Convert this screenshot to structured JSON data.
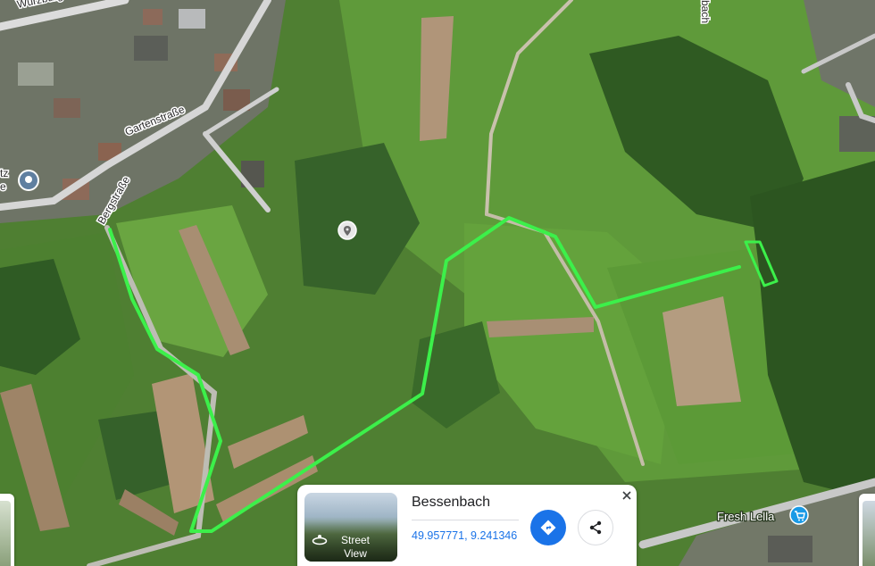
{
  "map": {
    "type": "satellite",
    "road_labels": {
      "wurzburger": "Würzburger Str.",
      "garten": "Gartenstraße",
      "berg": "Bergstraße",
      "bach": "bach",
      "left_edge_top": "tz",
      "left_edge_bottom": "e"
    },
    "place_label": "Fresh Lella",
    "route_color": "#3cf04a",
    "icons": [
      "location-pin-icon",
      "place-pin-icon",
      "shopping-cart-icon"
    ]
  },
  "info_card": {
    "place_name": "Bessenbach",
    "coordinates": "49.957771, 9.241346",
    "street_view_line1": "Street",
    "street_view_line2": "View",
    "icons": [
      "street-view-icon",
      "directions-icon",
      "share-icon",
      "close-icon"
    ]
  }
}
